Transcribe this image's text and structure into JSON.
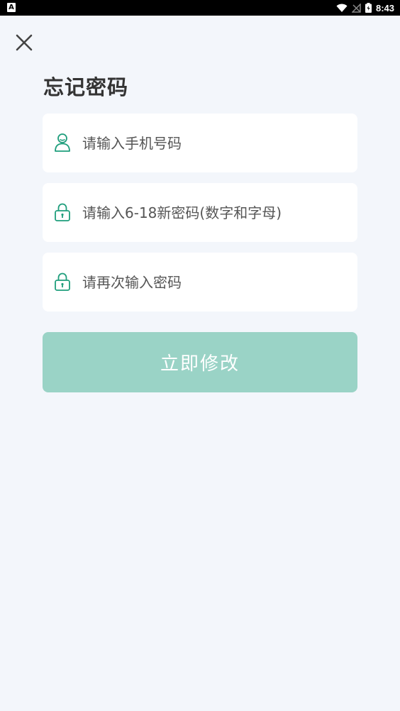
{
  "status_bar": {
    "left_badge": "A",
    "time": "8:43",
    "icons": [
      "wifi-icon",
      "signal-icon",
      "battery-icon"
    ]
  },
  "header": {
    "close_icon": "close-icon",
    "title": "忘记密码"
  },
  "form": {
    "phone": {
      "placeholder": "请输入手机号码",
      "value": "",
      "icon": "user-icon"
    },
    "new_password": {
      "placeholder": "请输入6-18新密码(数字和字母)",
      "value": "",
      "icon": "lock-icon"
    },
    "confirm_password": {
      "placeholder": "请再次输入密码",
      "value": "",
      "icon": "lock-icon"
    },
    "submit_label": "立即修改"
  },
  "colors": {
    "accent": "#1f9e7c",
    "button_bg": "#9ad3c6",
    "page_bg": "#f3f6fb"
  }
}
